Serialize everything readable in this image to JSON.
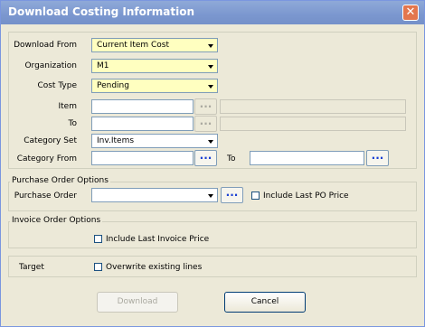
{
  "window": {
    "title": "Download Costing Information"
  },
  "fields": {
    "download_from": {
      "label": "Download From",
      "value": "Current Item Cost"
    },
    "organization": {
      "label": "Organization",
      "value": "M1"
    },
    "cost_type": {
      "label": "Cost Type",
      "value": "Pending"
    },
    "item": {
      "label": "Item",
      "value": ""
    },
    "to": {
      "label": "To",
      "value": ""
    },
    "category_set": {
      "label": "Category Set",
      "value": "Inv.Items"
    },
    "category_from": {
      "label": "Category From",
      "value": ""
    },
    "category_to": {
      "label": "To",
      "value": ""
    }
  },
  "lookup_button": {
    "label": "..."
  },
  "purchase_order": {
    "group_label": "Purchase Order Options",
    "label": "Purchase Order",
    "value": "",
    "include_last_po_price": {
      "label": "Include Last PO Price",
      "checked": false
    }
  },
  "invoice_order": {
    "group_label": "Invoice Order Options",
    "include_last_invoice_price": {
      "label": "Include Last Invoice Price",
      "checked": false
    }
  },
  "target": {
    "label": "Target",
    "overwrite_existing_lines": {
      "label": "Overwrite existing lines",
      "checked": false
    }
  },
  "buttons": {
    "download": "Download",
    "cancel": "Cancel"
  },
  "colors": {
    "required_field": "#ffffc0",
    "titlebar": "#7b97cf",
    "dialog_bg": "#ece9d8",
    "lookup_dots": "#1a3fd4"
  }
}
